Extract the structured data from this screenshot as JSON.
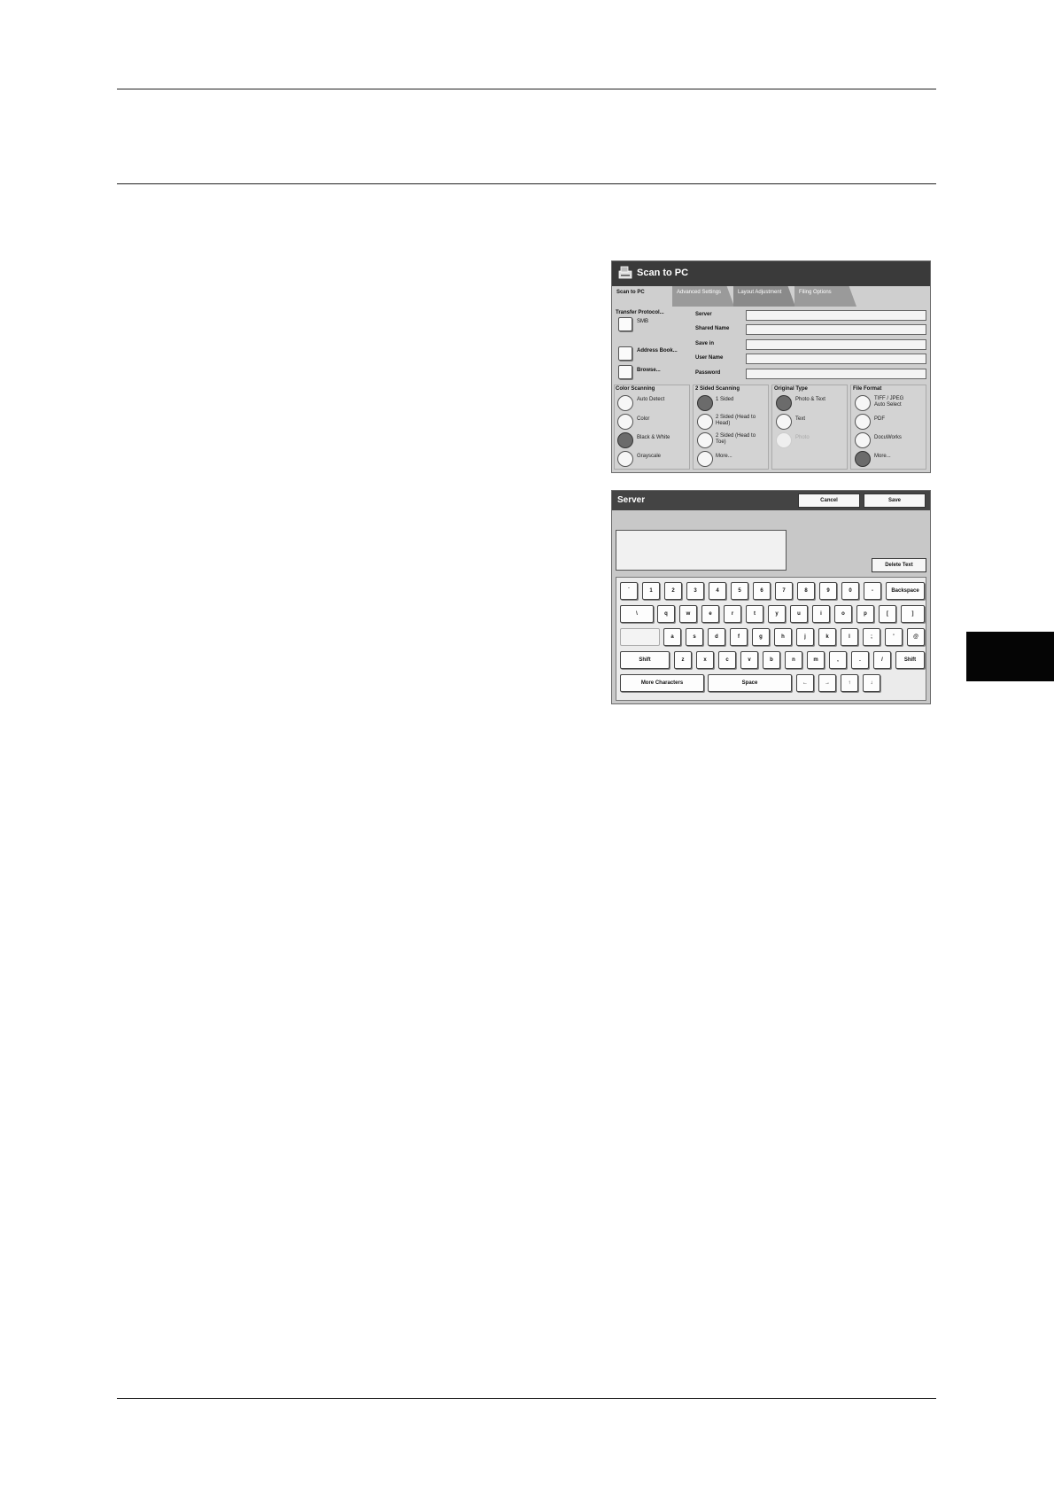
{
  "scan_to_pc": {
    "title": "Scan to PC",
    "tabs": [
      {
        "label": "Scan to PC",
        "active": true
      },
      {
        "label": "Advanced Settings",
        "active": false
      },
      {
        "label": "Layout Adjustment",
        "active": false
      },
      {
        "label": "Filing Options",
        "active": false
      }
    ],
    "transfer_protocol_label": "Transfer Protocol...",
    "transfer_protocol_value": "SMB",
    "address_book_label": "Address Book...",
    "browse_label": "Browse...",
    "fields": [
      "Server",
      "Shared Name",
      "Save in",
      "User Name",
      "Password"
    ],
    "groups": [
      {
        "title": "Color Scanning",
        "options": [
          {
            "label": "Auto Detect",
            "state": "off"
          },
          {
            "label": "Color",
            "state": "off"
          },
          {
            "label": "Black & White",
            "state": "on"
          },
          {
            "label": "Grayscale",
            "state": "off"
          }
        ]
      },
      {
        "title": "2 Sided Scanning",
        "options": [
          {
            "label": "1 Sided",
            "state": "on"
          },
          {
            "label": "2 Sided (Head to Head)",
            "state": "off"
          },
          {
            "label": "2 Sided (Head to Toe)",
            "state": "off"
          },
          {
            "label": "More...",
            "state": "off"
          }
        ]
      },
      {
        "title": "Original Type",
        "options": [
          {
            "label": "Photo & Text",
            "state": "on"
          },
          {
            "label": "Text",
            "state": "off"
          },
          {
            "label": "Photo",
            "state": "disabled"
          }
        ]
      },
      {
        "title": "File Format",
        "options": [
          {
            "label": "TIFF / JPEG Auto Select",
            "state": "off"
          },
          {
            "label": "PDF",
            "state": "off"
          },
          {
            "label": "DocuWorks",
            "state": "off"
          },
          {
            "label": "More...",
            "state": "on"
          }
        ]
      }
    ]
  },
  "server_keyboard": {
    "title": "Server",
    "cancel_label": "Cancel",
    "save_label": "Save",
    "delete_text_label": "Delete Text",
    "rows": [
      [
        "`",
        "1",
        "2",
        "3",
        "4",
        "5",
        "6",
        "7",
        "8",
        "9",
        "0",
        "-",
        "Backspace"
      ],
      [
        "\\",
        "q",
        "w",
        "e",
        "r",
        "t",
        "y",
        "u",
        "i",
        "o",
        "p",
        "[",
        "]"
      ],
      [
        "",
        "a",
        "s",
        "d",
        "f",
        "g",
        "h",
        "j",
        "k",
        "l",
        ";",
        "'",
        "@"
      ],
      [
        "Shift",
        "z",
        "x",
        "c",
        "v",
        "b",
        "n",
        "m",
        ",",
        ".",
        "/",
        "Shift"
      ],
      [
        "More Characters",
        "Space",
        "←",
        "→",
        "↑",
        "↓"
      ]
    ]
  }
}
